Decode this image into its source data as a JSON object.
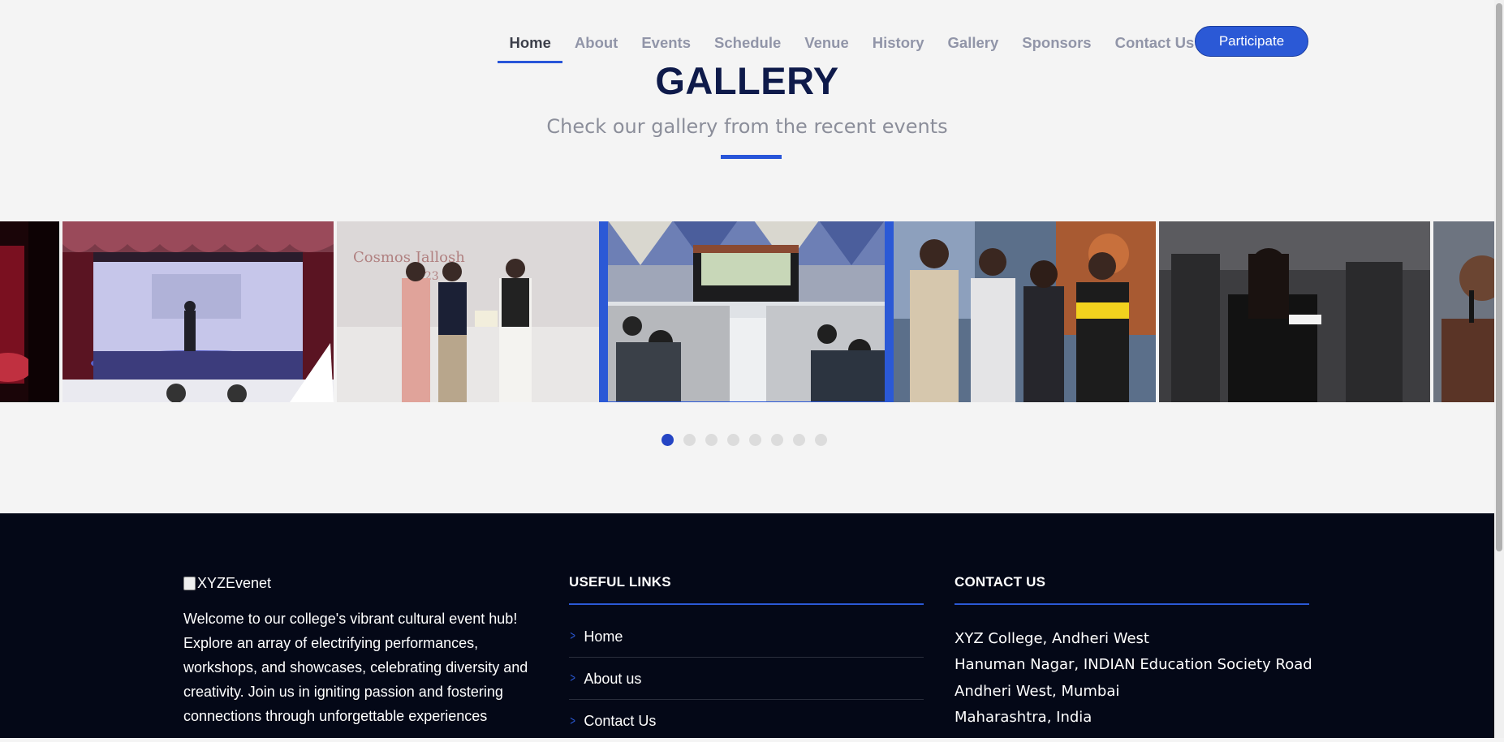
{
  "nav": {
    "items": [
      {
        "label": "Home",
        "active": true
      },
      {
        "label": "About"
      },
      {
        "label": "Events"
      },
      {
        "label": "Schedule"
      },
      {
        "label": "Venue"
      },
      {
        "label": "History"
      },
      {
        "label": "Gallery"
      },
      {
        "label": "Sponsors"
      },
      {
        "label": "Contact Us"
      }
    ],
    "cta_label": "Participate"
  },
  "gallery": {
    "title": "GALLERY",
    "subtitle": "Check our gallery from the recent events",
    "slides": [
      {
        "alt": "red-stage-photo"
      },
      {
        "alt": "dance-performance-photo"
      },
      {
        "alt": "award-presentation-photo"
      },
      {
        "alt": "auditorium-crowd-photo",
        "active": true
      },
      {
        "alt": "group-photo"
      },
      {
        "alt": "girl-writing-photo"
      },
      {
        "alt": "speaker-mic-photo"
      }
    ],
    "dot_count": 8,
    "active_dot": 0
  },
  "footer": {
    "logo_alt": "XYZEvenet",
    "description": "Welcome to our college's vibrant cultural event hub! Explore an array of electrifying performances, workshops, and showcases, celebrating diversity and creativity. Join us in igniting passion and fostering connections through unforgettable experiences",
    "links_title": "USEFUL LINKS",
    "links": [
      "Home",
      "About us",
      "Contact Us"
    ],
    "contact_title": "CONTACT US",
    "address": [
      "XYZ College, Andheri West",
      "Hanuman Nagar, INDIAN Education Society Road",
      "Andheri West, Mumbai",
      "Maharashtra, India"
    ]
  },
  "colors": {
    "accent": "#2b59d6",
    "title": "#0e1a4a",
    "footer_bg": "#040817"
  }
}
